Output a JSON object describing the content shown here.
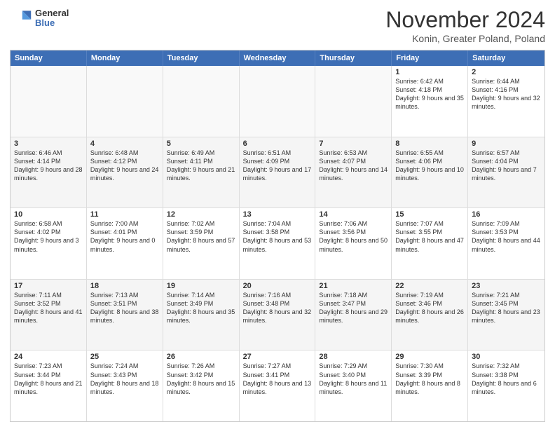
{
  "header": {
    "logo_line1": "General",
    "logo_line2": "Blue",
    "month_title": "November 2024",
    "location": "Konin, Greater Poland, Poland"
  },
  "weekdays": [
    "Sunday",
    "Monday",
    "Tuesday",
    "Wednesday",
    "Thursday",
    "Friday",
    "Saturday"
  ],
  "rows": [
    [
      {
        "day": "",
        "info": "",
        "empty": true
      },
      {
        "day": "",
        "info": "",
        "empty": true
      },
      {
        "day": "",
        "info": "",
        "empty": true
      },
      {
        "day": "",
        "info": "",
        "empty": true
      },
      {
        "day": "",
        "info": "",
        "empty": true
      },
      {
        "day": "1",
        "info": "Sunrise: 6:42 AM\nSunset: 4:18 PM\nDaylight: 9 hours\nand 35 minutes.",
        "empty": false
      },
      {
        "day": "2",
        "info": "Sunrise: 6:44 AM\nSunset: 4:16 PM\nDaylight: 9 hours\nand 32 minutes.",
        "empty": false
      }
    ],
    [
      {
        "day": "3",
        "info": "Sunrise: 6:46 AM\nSunset: 4:14 PM\nDaylight: 9 hours\nand 28 minutes.",
        "empty": false
      },
      {
        "day": "4",
        "info": "Sunrise: 6:48 AM\nSunset: 4:12 PM\nDaylight: 9 hours\nand 24 minutes.",
        "empty": false
      },
      {
        "day": "5",
        "info": "Sunrise: 6:49 AM\nSunset: 4:11 PM\nDaylight: 9 hours\nand 21 minutes.",
        "empty": false
      },
      {
        "day": "6",
        "info": "Sunrise: 6:51 AM\nSunset: 4:09 PM\nDaylight: 9 hours\nand 17 minutes.",
        "empty": false
      },
      {
        "day": "7",
        "info": "Sunrise: 6:53 AM\nSunset: 4:07 PM\nDaylight: 9 hours\nand 14 minutes.",
        "empty": false
      },
      {
        "day": "8",
        "info": "Sunrise: 6:55 AM\nSunset: 4:06 PM\nDaylight: 9 hours\nand 10 minutes.",
        "empty": false
      },
      {
        "day": "9",
        "info": "Sunrise: 6:57 AM\nSunset: 4:04 PM\nDaylight: 9 hours\nand 7 minutes.",
        "empty": false
      }
    ],
    [
      {
        "day": "10",
        "info": "Sunrise: 6:58 AM\nSunset: 4:02 PM\nDaylight: 9 hours\nand 3 minutes.",
        "empty": false
      },
      {
        "day": "11",
        "info": "Sunrise: 7:00 AM\nSunset: 4:01 PM\nDaylight: 9 hours\nand 0 minutes.",
        "empty": false
      },
      {
        "day": "12",
        "info": "Sunrise: 7:02 AM\nSunset: 3:59 PM\nDaylight: 8 hours\nand 57 minutes.",
        "empty": false
      },
      {
        "day": "13",
        "info": "Sunrise: 7:04 AM\nSunset: 3:58 PM\nDaylight: 8 hours\nand 53 minutes.",
        "empty": false
      },
      {
        "day": "14",
        "info": "Sunrise: 7:06 AM\nSunset: 3:56 PM\nDaylight: 8 hours\nand 50 minutes.",
        "empty": false
      },
      {
        "day": "15",
        "info": "Sunrise: 7:07 AM\nSunset: 3:55 PM\nDaylight: 8 hours\nand 47 minutes.",
        "empty": false
      },
      {
        "day": "16",
        "info": "Sunrise: 7:09 AM\nSunset: 3:53 PM\nDaylight: 8 hours\nand 44 minutes.",
        "empty": false
      }
    ],
    [
      {
        "day": "17",
        "info": "Sunrise: 7:11 AM\nSunset: 3:52 PM\nDaylight: 8 hours\nand 41 minutes.",
        "empty": false
      },
      {
        "day": "18",
        "info": "Sunrise: 7:13 AM\nSunset: 3:51 PM\nDaylight: 8 hours\nand 38 minutes.",
        "empty": false
      },
      {
        "day": "19",
        "info": "Sunrise: 7:14 AM\nSunset: 3:49 PM\nDaylight: 8 hours\nand 35 minutes.",
        "empty": false
      },
      {
        "day": "20",
        "info": "Sunrise: 7:16 AM\nSunset: 3:48 PM\nDaylight: 8 hours\nand 32 minutes.",
        "empty": false
      },
      {
        "day": "21",
        "info": "Sunrise: 7:18 AM\nSunset: 3:47 PM\nDaylight: 8 hours\nand 29 minutes.",
        "empty": false
      },
      {
        "day": "22",
        "info": "Sunrise: 7:19 AM\nSunset: 3:46 PM\nDaylight: 8 hours\nand 26 minutes.",
        "empty": false
      },
      {
        "day": "23",
        "info": "Sunrise: 7:21 AM\nSunset: 3:45 PM\nDaylight: 8 hours\nand 23 minutes.",
        "empty": false
      }
    ],
    [
      {
        "day": "24",
        "info": "Sunrise: 7:23 AM\nSunset: 3:44 PM\nDaylight: 8 hours\nand 21 minutes.",
        "empty": false
      },
      {
        "day": "25",
        "info": "Sunrise: 7:24 AM\nSunset: 3:43 PM\nDaylight: 8 hours\nand 18 minutes.",
        "empty": false
      },
      {
        "day": "26",
        "info": "Sunrise: 7:26 AM\nSunset: 3:42 PM\nDaylight: 8 hours\nand 15 minutes.",
        "empty": false
      },
      {
        "day": "27",
        "info": "Sunrise: 7:27 AM\nSunset: 3:41 PM\nDaylight: 8 hours\nand 13 minutes.",
        "empty": false
      },
      {
        "day": "28",
        "info": "Sunrise: 7:29 AM\nSunset: 3:40 PM\nDaylight: 8 hours\nand 11 minutes.",
        "empty": false
      },
      {
        "day": "29",
        "info": "Sunrise: 7:30 AM\nSunset: 3:39 PM\nDaylight: 8 hours\nand 8 minutes.",
        "empty": false
      },
      {
        "day": "30",
        "info": "Sunrise: 7:32 AM\nSunset: 3:38 PM\nDaylight: 8 hours\nand 6 minutes.",
        "empty": false
      }
    ]
  ]
}
